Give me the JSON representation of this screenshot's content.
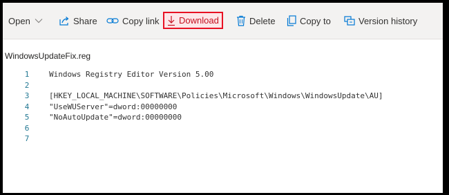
{
  "toolbar": {
    "open_label": "Open",
    "share_label": "Share",
    "copy_link_label": "Copy link",
    "download_label": "Download",
    "delete_label": "Delete",
    "copy_to_label": "Copy to",
    "version_history_label": "Version history",
    "highlight_color": "#e81123"
  },
  "file": {
    "name": "WindowsUpdateFix.reg",
    "lines": [
      {
        "number": "1",
        "text": "Windows Registry Editor Version 5.00"
      },
      {
        "number": "2",
        "text": ""
      },
      {
        "number": "3",
        "text": "[HKEY_LOCAL_MACHINE\\SOFTWARE\\Policies\\Microsoft\\Windows\\WindowsUpdate\\AU]"
      },
      {
        "number": "4",
        "text": "\"UseWUServer\"=dword:00000000"
      },
      {
        "number": "5",
        "text": "\"NoAutoUpdate\"=dword:00000000"
      },
      {
        "number": "6",
        "text": ""
      },
      {
        "number": "7",
        "text": ""
      }
    ]
  }
}
